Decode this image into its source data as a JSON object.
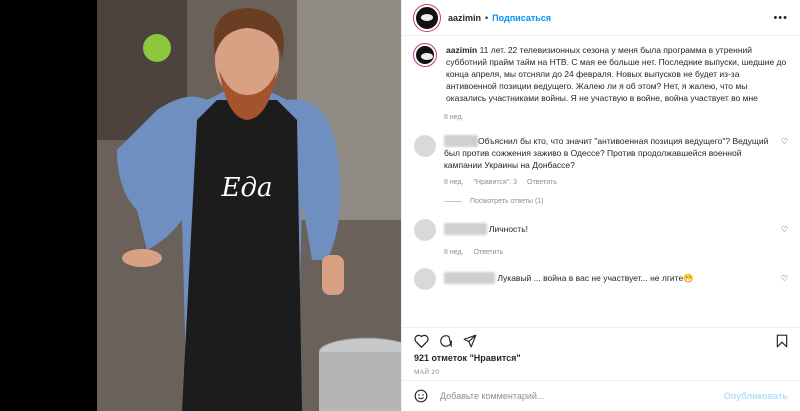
{
  "post": {
    "username": "aazimin",
    "follow": "Подписаться",
    "more": "•••",
    "caption": "11 лет. 22 телевизионных сезона у меня была программа в утренний субботний прайм тайм на НТВ. С мая ее больше нет. Последние выпуски, шедшие до конца апреля, мы отсняли до 24 февраля. Новых выпусков не будет из-за антивоенной позиции ведущего. Жалею ли я об этом? Нет, я жалею, что мы оказались участниками войны. Я не участвую в войне, война участвует во мне",
    "caption_age": "8 нед.",
    "apron_text": "Eда",
    "likes": "921 отметок \"Нравится\"",
    "date": "МАЙ 20",
    "add_placeholder": "Добавьте комментарий...",
    "publish": "Опубликовать"
  },
  "comments": [
    {
      "text": "Объяснил бы кто, что значит \"антивоенная позиция ведущего\"? Ведущий был против сожжения заживо в Одессе? Против продолжавшейся военной кампании Украины на Донбассе?",
      "age": "8 нед.",
      "likes": "\"Нравится\": 3",
      "reply": "Ответить",
      "view_replies": "Посмотреть ответы (1)"
    },
    {
      "text": "Личность!",
      "age": "8 нед.",
      "reply": "Ответить"
    },
    {
      "text": "Лукавый ... война в вас не участвует... не лгите😁"
    }
  ],
  "colors": {
    "link": "#0095f6",
    "muted": "#8e8e8e",
    "publish": "#b2dffc"
  }
}
